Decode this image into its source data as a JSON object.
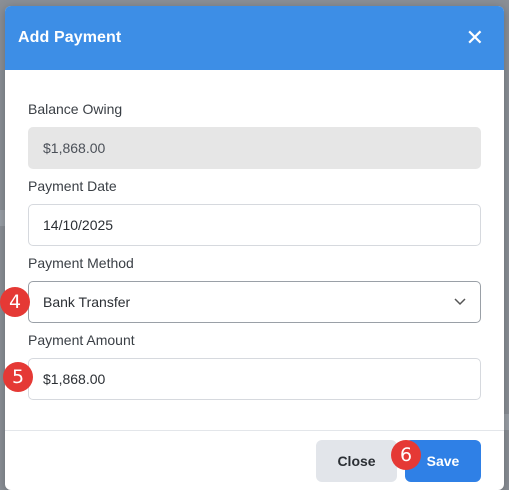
{
  "modal": {
    "title": "Add Payment",
    "close_icon": "close-icon"
  },
  "form": {
    "balance_owing": {
      "label": "Balance Owing",
      "value": "$1,868.00"
    },
    "payment_date": {
      "label": "Payment Date",
      "value": "14/10/2025"
    },
    "payment_method": {
      "label": "Payment Method",
      "value": "Bank Transfer",
      "icon": "chevron-down-icon"
    },
    "payment_amount": {
      "label": "Payment Amount",
      "value": "$1,868.00"
    }
  },
  "footer": {
    "close_label": "Close",
    "save_label": "Save"
  },
  "badges": {
    "method": "4",
    "amount": "5",
    "save": "6"
  },
  "colors": {
    "header": "#3d8ee6",
    "primary": "#2f80e6",
    "badge": "#e53935"
  }
}
